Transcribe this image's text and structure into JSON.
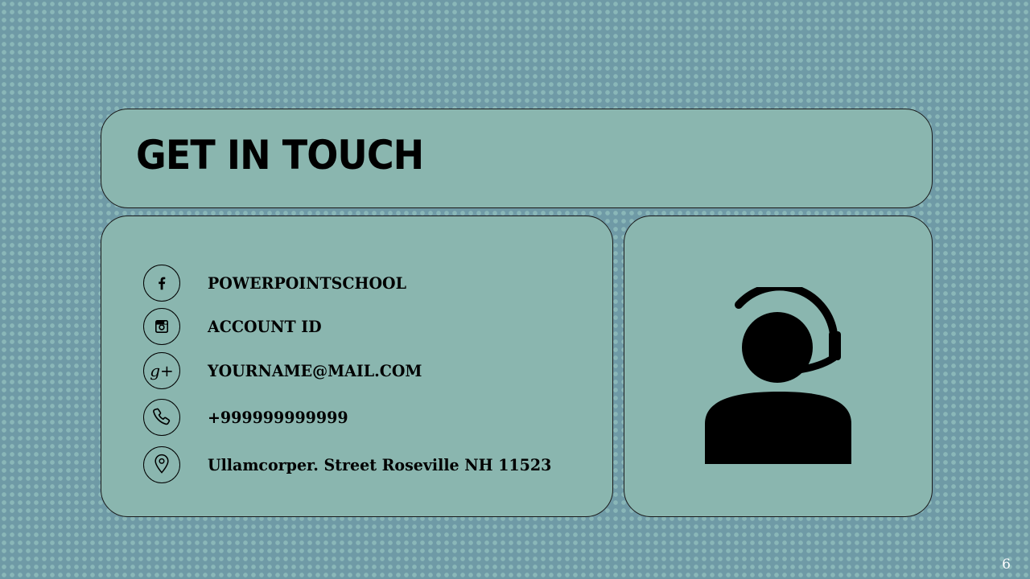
{
  "slide": {
    "title": "GET IN TOUCH",
    "page_number": "6"
  },
  "contacts": [
    {
      "icon": "facebook-icon",
      "text": "POWERPOINTSCHOOL"
    },
    {
      "icon": "instagram-icon",
      "text": "ACCOUNT ID"
    },
    {
      "icon": "google-plus-icon",
      "text": "YOURNAME@MAIL.COM"
    },
    {
      "icon": "phone-icon",
      "text": "+999999999999"
    },
    {
      "icon": "location-pin-icon",
      "text": "Ullamcorper. Street Roseville NH 11523"
    }
  ],
  "avatar": {
    "icon": "customer-support-headset-icon"
  },
  "colors": {
    "background": "#6f9aa6",
    "dots": "#8ab7b8",
    "panel": "#8ab6af",
    "text": "#000000",
    "page_number": "#ffffff"
  }
}
